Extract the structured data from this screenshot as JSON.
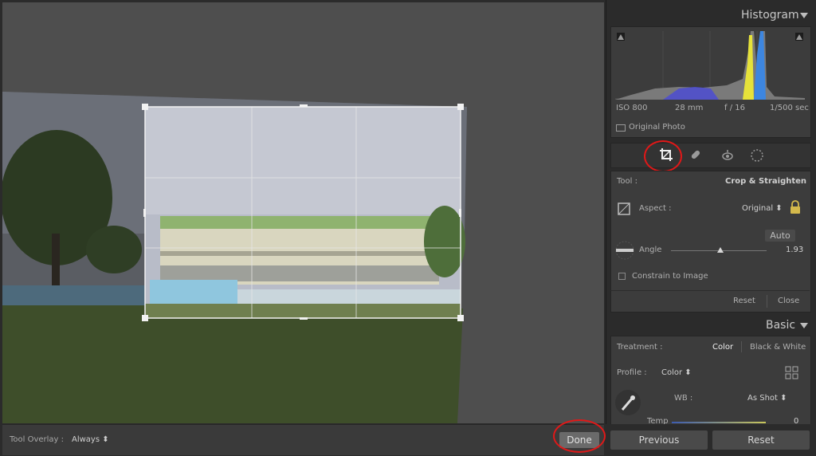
{
  "histogram": {
    "title": "Histogram",
    "iso": "ISO 800",
    "focal": "28 mm",
    "aperture": "f / 16",
    "shutter": "1/500 sec",
    "original_photo": "Original Photo"
  },
  "tools": {
    "icons": [
      "crop-icon",
      "heal-icon",
      "redeye-icon",
      "radial-icon"
    ]
  },
  "crop": {
    "tool_label": "Tool :",
    "tool_value": "Crop & Straighten",
    "aspect_label": "Aspect :",
    "aspect_value": "Original ⬍",
    "auto_label": "Auto",
    "angle_label": "Angle",
    "angle_value": "1.93",
    "constrain_label": "Constrain to Image",
    "reset_label": "Reset",
    "close_label": "Close"
  },
  "basic": {
    "title": "Basic",
    "treatment_label": "Treatment :",
    "treatment_color": "Color",
    "treatment_bw": "Black & White",
    "profile_label": "Profile :",
    "profile_value": "Color ⬍",
    "wb_label": "WB :",
    "wb_value": "As Shot ⬍",
    "temp_label": "Temp",
    "temp_value": "0"
  },
  "bottom": {
    "tool_overlay_label": "Tool Overlay :",
    "tool_overlay_value": "Always ⬍",
    "done_label": "Done",
    "previous_label": "Previous",
    "reset_label": "Reset"
  },
  "colors": {
    "accent_highlight": "#e01818",
    "panel_bg": "#2b2b2b",
    "canvas_bg": "#4e4e4e"
  }
}
